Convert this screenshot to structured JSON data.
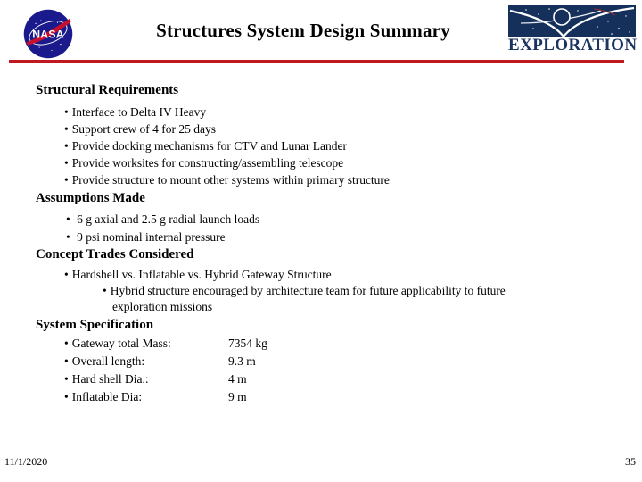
{
  "header": {
    "title": "Structures System Design Summary",
    "nasa_logo_name": "nasa-meatball-logo",
    "nasa_logo_text": "NASA",
    "exploration_logo_text": "EXPLORATION",
    "rule_color": "#c01820",
    "nasa_blue": "#1a1a8c",
    "nasa_red": "#c8102e",
    "exploration_navy": "#16305c"
  },
  "sections": [
    {
      "heading": "Structural Requirements",
      "bullets": [
        "Interface to Delta IV Heavy",
        "Support crew of 4 for 25 days",
        "Provide docking mechanisms for CTV and Lunar Lander",
        "Provide worksites for constructing/assembling telescope",
        "Provide structure to mount other systems within primary structure"
      ]
    },
    {
      "heading": "Assumptions Made",
      "bullets": [
        "6 g axial and 2.5 g radial launch loads",
        "9 psi nominal internal pressure"
      ]
    },
    {
      "heading": "Concept Trades Considered",
      "bullets": [
        "Hardshell vs. Inflatable vs. Hybrid Gateway Structure"
      ],
      "subbullet": {
        "line1": "Hybrid structure encouraged by architecture team for future applicability to future",
        "line2": "exploration missions"
      }
    },
    {
      "heading": "System Specification",
      "specs": [
        {
          "label": "Gateway total Mass:",
          "value": "7354 kg"
        },
        {
          "label": "Overall length:",
          "value": "9.3 m"
        },
        {
          "label": "Hard shell Dia.:",
          "value": "4 m"
        },
        {
          "label": "Inflatable Dia:",
          "value": "9 m"
        }
      ]
    }
  ],
  "bullet_glyph": "•",
  "footer": {
    "date": "11/1/2020",
    "page": "35"
  }
}
